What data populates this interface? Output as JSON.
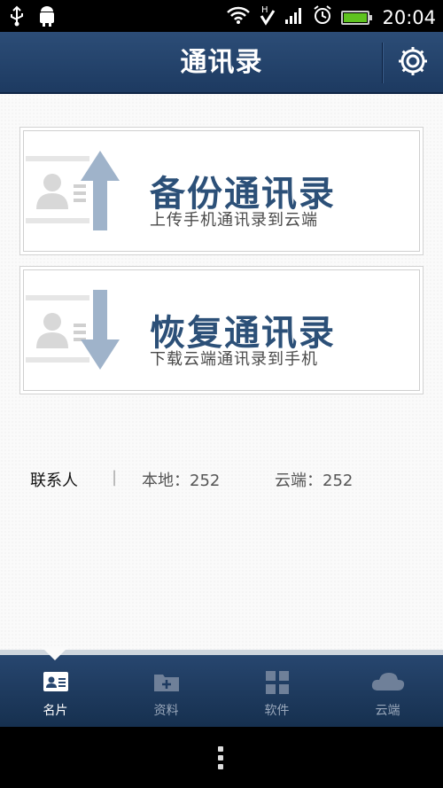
{
  "status_bar": {
    "time": "20:04",
    "icons": [
      "usb-icon",
      "android-debug-icon",
      "wifi-icon",
      "sync-icon",
      "signal-icon",
      "alarm-icon",
      "battery-icon"
    ]
  },
  "header": {
    "title": "通讯录",
    "settings_icon": "gear-icon"
  },
  "cards": [
    {
      "title": "备份通讯录",
      "subtitle": "上传手机通讯录到云端",
      "icon": "contact-upload-icon"
    },
    {
      "title": "恢复通讯录",
      "subtitle": "下载云端通讯录到手机",
      "icon": "contact-download-icon"
    }
  ],
  "stats": {
    "label": "联系人",
    "separator": "|",
    "local": "本地：252",
    "cloud": "云端：252"
  },
  "tabs": [
    {
      "label": "名片",
      "icon": "business-card-icon",
      "active": true
    },
    {
      "label": "资料",
      "icon": "folder-add-icon",
      "active": false
    },
    {
      "label": "软件",
      "icon": "apps-grid-icon",
      "active": false
    },
    {
      "label": "云端",
      "icon": "cloud-icon",
      "active": false
    }
  ],
  "colors": {
    "header_bg": "#1d3a61",
    "card_title": "#2c5078",
    "tab_active": "#ffffff",
    "tab_inactive": "#9aa8bb"
  }
}
